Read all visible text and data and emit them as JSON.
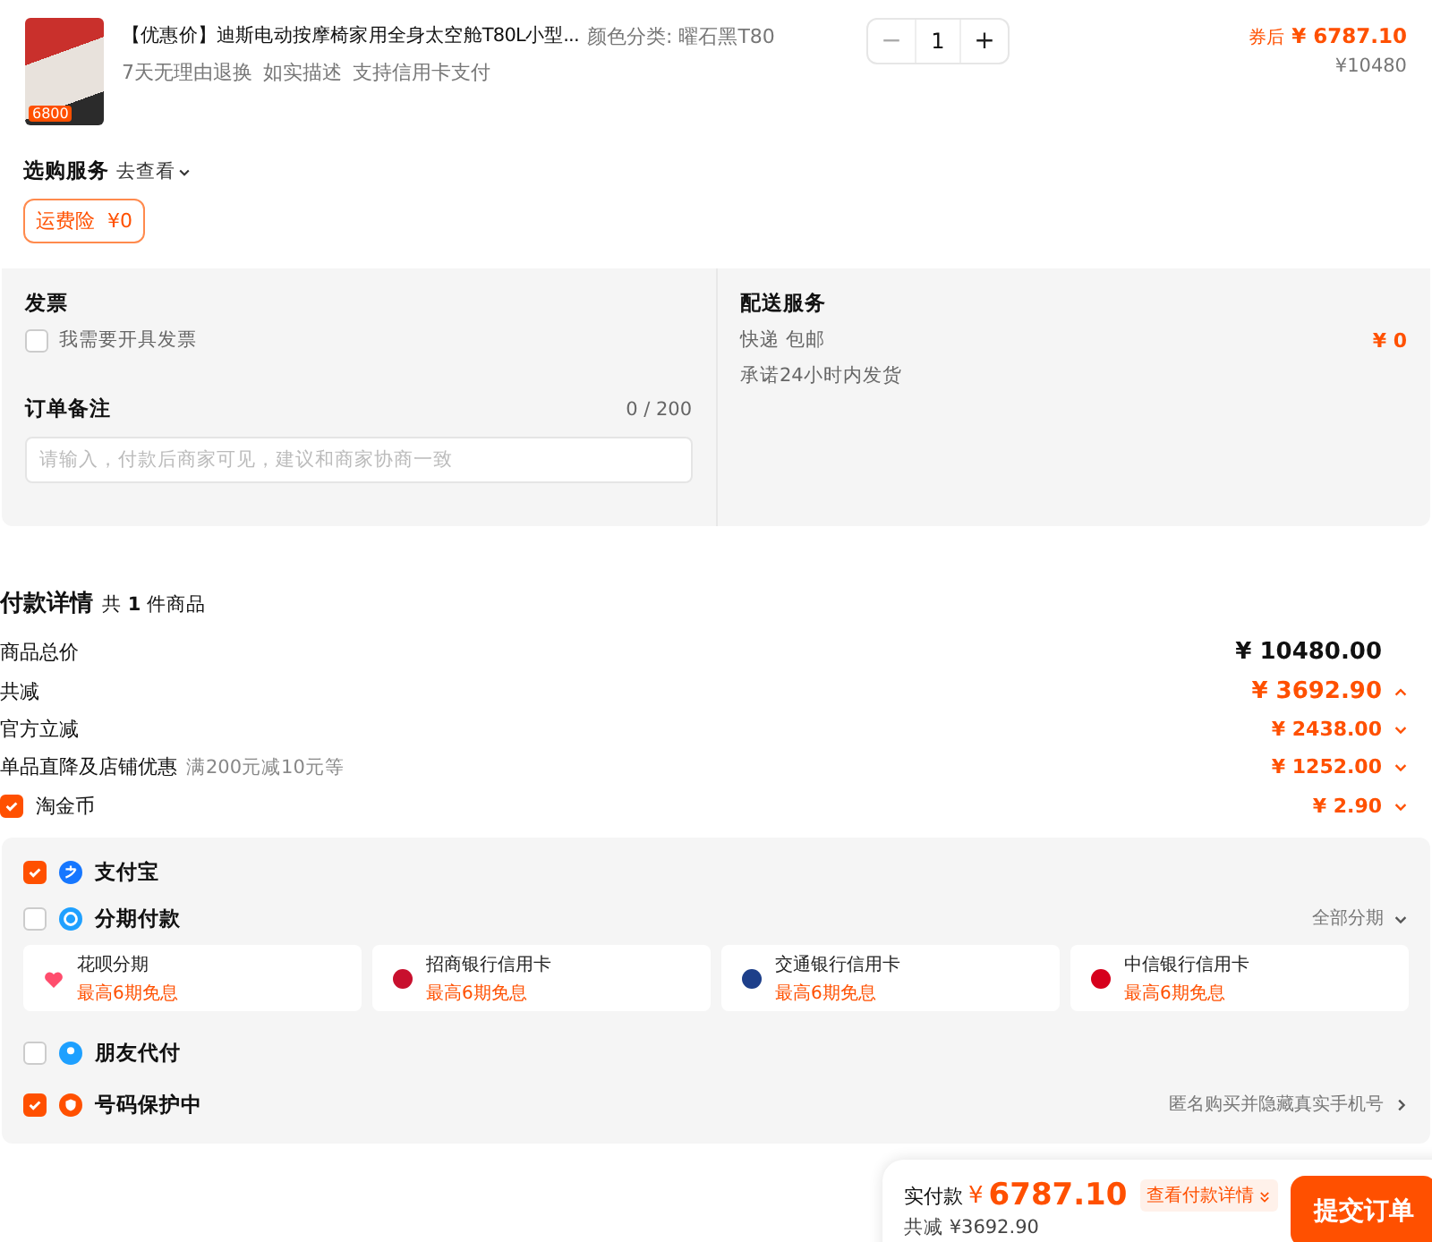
{
  "product": {
    "image_badge": "6800",
    "title": "【优惠价】迪斯电动按摩椅家用全身太空舱T80L小型...",
    "tags": [
      "7天无理由退换",
      "如实描述",
      "支持信用卡支付"
    ],
    "spec": "颜色分类: 曜石黑T80",
    "quantity": "1",
    "minus": "−",
    "plus": "+",
    "price_label": "券后",
    "price": "¥ 6787.10",
    "original_price": "¥10480"
  },
  "services": {
    "title": "选购服务",
    "link": "去查看",
    "chip": "运费险  ¥0"
  },
  "invoice": {
    "title": "发票",
    "option": "我需要开具发票",
    "checked": false
  },
  "note": {
    "title": "订单备注",
    "count": "0 / 200",
    "placeholder": "请输入，付款后商家可见，建议和商家协商一致"
  },
  "delivery": {
    "title": "配送服务",
    "method": "快递 包邮",
    "promise": "承诺24小时内发货",
    "price": "¥ 0"
  },
  "payment_details": {
    "title": "付款详情",
    "count_prefix": "共",
    "count": "1",
    "count_suffix": "件商品",
    "rows": [
      {
        "kind": "total",
        "label": "商品总价",
        "amount": "¥ 10480.00"
      },
      {
        "kind": "discount_total",
        "label": "共减",
        "amount": "¥ 3692.90",
        "expanded": true
      },
      {
        "kind": "discount",
        "label": "官方立减",
        "amount": "¥ 2438.00",
        "expanded": false
      },
      {
        "kind": "discount",
        "label": "单品直降及店铺优惠",
        "note": "满200元减10元等",
        "amount": "¥ 1252.00",
        "expanded": false
      },
      {
        "kind": "check",
        "label": "淘金币",
        "amount": "¥ 2.90",
        "checked": true,
        "expanded": false
      }
    ]
  },
  "payment_methods": [
    {
      "kind": "alipay",
      "label": "支付宝",
      "checked": true
    },
    {
      "kind": "installment",
      "label": "分期付款",
      "checked": false,
      "right_text": "全部分期"
    },
    {
      "kind": "friend",
      "label": "朋友代付",
      "checked": false
    },
    {
      "kind": "protection",
      "label": "号码保护中",
      "checked": true,
      "right_text": "匿名购买并隐藏真实手机号"
    }
  ],
  "installment_options": [
    {
      "kind": "huabei",
      "name": "花呗分期",
      "promo": "最高6期免息"
    },
    {
      "kind": "cmb",
      "name": "招商银行信用卡",
      "promo": "最高6期免息"
    },
    {
      "kind": "bocom",
      "name": "交通银行信用卡",
      "promo": "最高6期免息"
    },
    {
      "kind": "citic",
      "name": "中信银行信用卡",
      "promo": "最高6期免息"
    }
  ],
  "footer": {
    "label": "实付款",
    "currency": "¥",
    "amount": "6787.10",
    "details_button": "查看付款详情",
    "saved": "共减 ¥3692.90",
    "submit": "提交订单"
  }
}
